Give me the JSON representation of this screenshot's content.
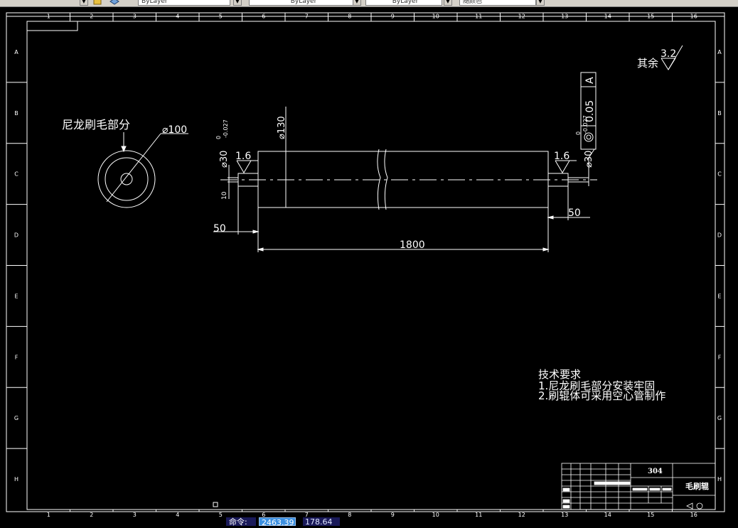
{
  "toolbar": {
    "layer_combo": "ByLayer",
    "linetype_combo": "ByLayer",
    "lineweight_combo": "ByLayer",
    "color_combo": "随颜色"
  },
  "frame": {
    "columns": [
      "1",
      "2",
      "3",
      "4",
      "5",
      "6",
      "7",
      "8",
      "9",
      "10",
      "11",
      "12",
      "13",
      "14",
      "15",
      "16"
    ],
    "rows": [
      "A",
      "B",
      "C",
      "D",
      "E",
      "F",
      "G",
      "H"
    ]
  },
  "drawing": {
    "brush_part_label": "尼龙刷毛部分",
    "brush_dia": "⌀100",
    "roller_dia": "⌀130",
    "left_shaft_dia": "⌀30",
    "left_tol_upper": "0",
    "left_tol_lower": "-0.027",
    "right_shaft_dia": "⌀30",
    "right_tol_upper": "0",
    "right_tol_lower": "-0.027",
    "rough_left": "1.6",
    "rough_right": "1.6",
    "rough_general_prefix": "其余",
    "rough_general_value": "3.2",
    "keyway": "10",
    "len_left": "50",
    "len_right": "50",
    "len_main": "1800",
    "tolerance_frame_value": "0.05",
    "tolerance_frame_datum": "A"
  },
  "notes": {
    "title": "技术要求",
    "line1": "1.尼龙刷毛部分安装牢固",
    "line2": "2.刷辊体可采用空心管制作"
  },
  "title_block": {
    "material": "304",
    "part_name": "毛刷辊"
  },
  "status": {
    "command_label": "命令:",
    "coord_x": "2463.39",
    "coord_y": "178.64"
  }
}
